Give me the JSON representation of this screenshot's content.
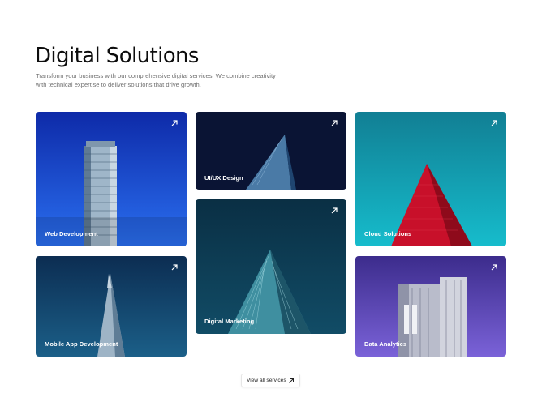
{
  "header": {
    "title": "Digital Solutions",
    "subtitle": "Transform your business with our comprehensive digital services. We combine creativity with technical expertise to deliver solutions that drive growth."
  },
  "services": [
    {
      "label": "Web Development",
      "icon": "arrow-up-right-icon"
    },
    {
      "label": "UI/UX Design",
      "icon": "arrow-up-right-icon"
    },
    {
      "label": "Cloud Solutions",
      "icon": "arrow-up-right-icon"
    },
    {
      "label": "Digital Marketing",
      "icon": "arrow-up-right-icon"
    },
    {
      "label": "Mobile App Development",
      "icon": "arrow-up-right-icon"
    },
    {
      "label": "Data Analytics",
      "icon": "arrow-up-right-icon"
    }
  ],
  "cta": {
    "label": "View all services",
    "icon": "arrow-up-right-icon"
  },
  "colors": {
    "web": "#1d4fd1",
    "uiux": "#0b1637",
    "cloud": "#12a4b4",
    "marketing": "#0c3a4e",
    "mobile": "#0f3a5c",
    "analytics": "#6a55c9"
  }
}
